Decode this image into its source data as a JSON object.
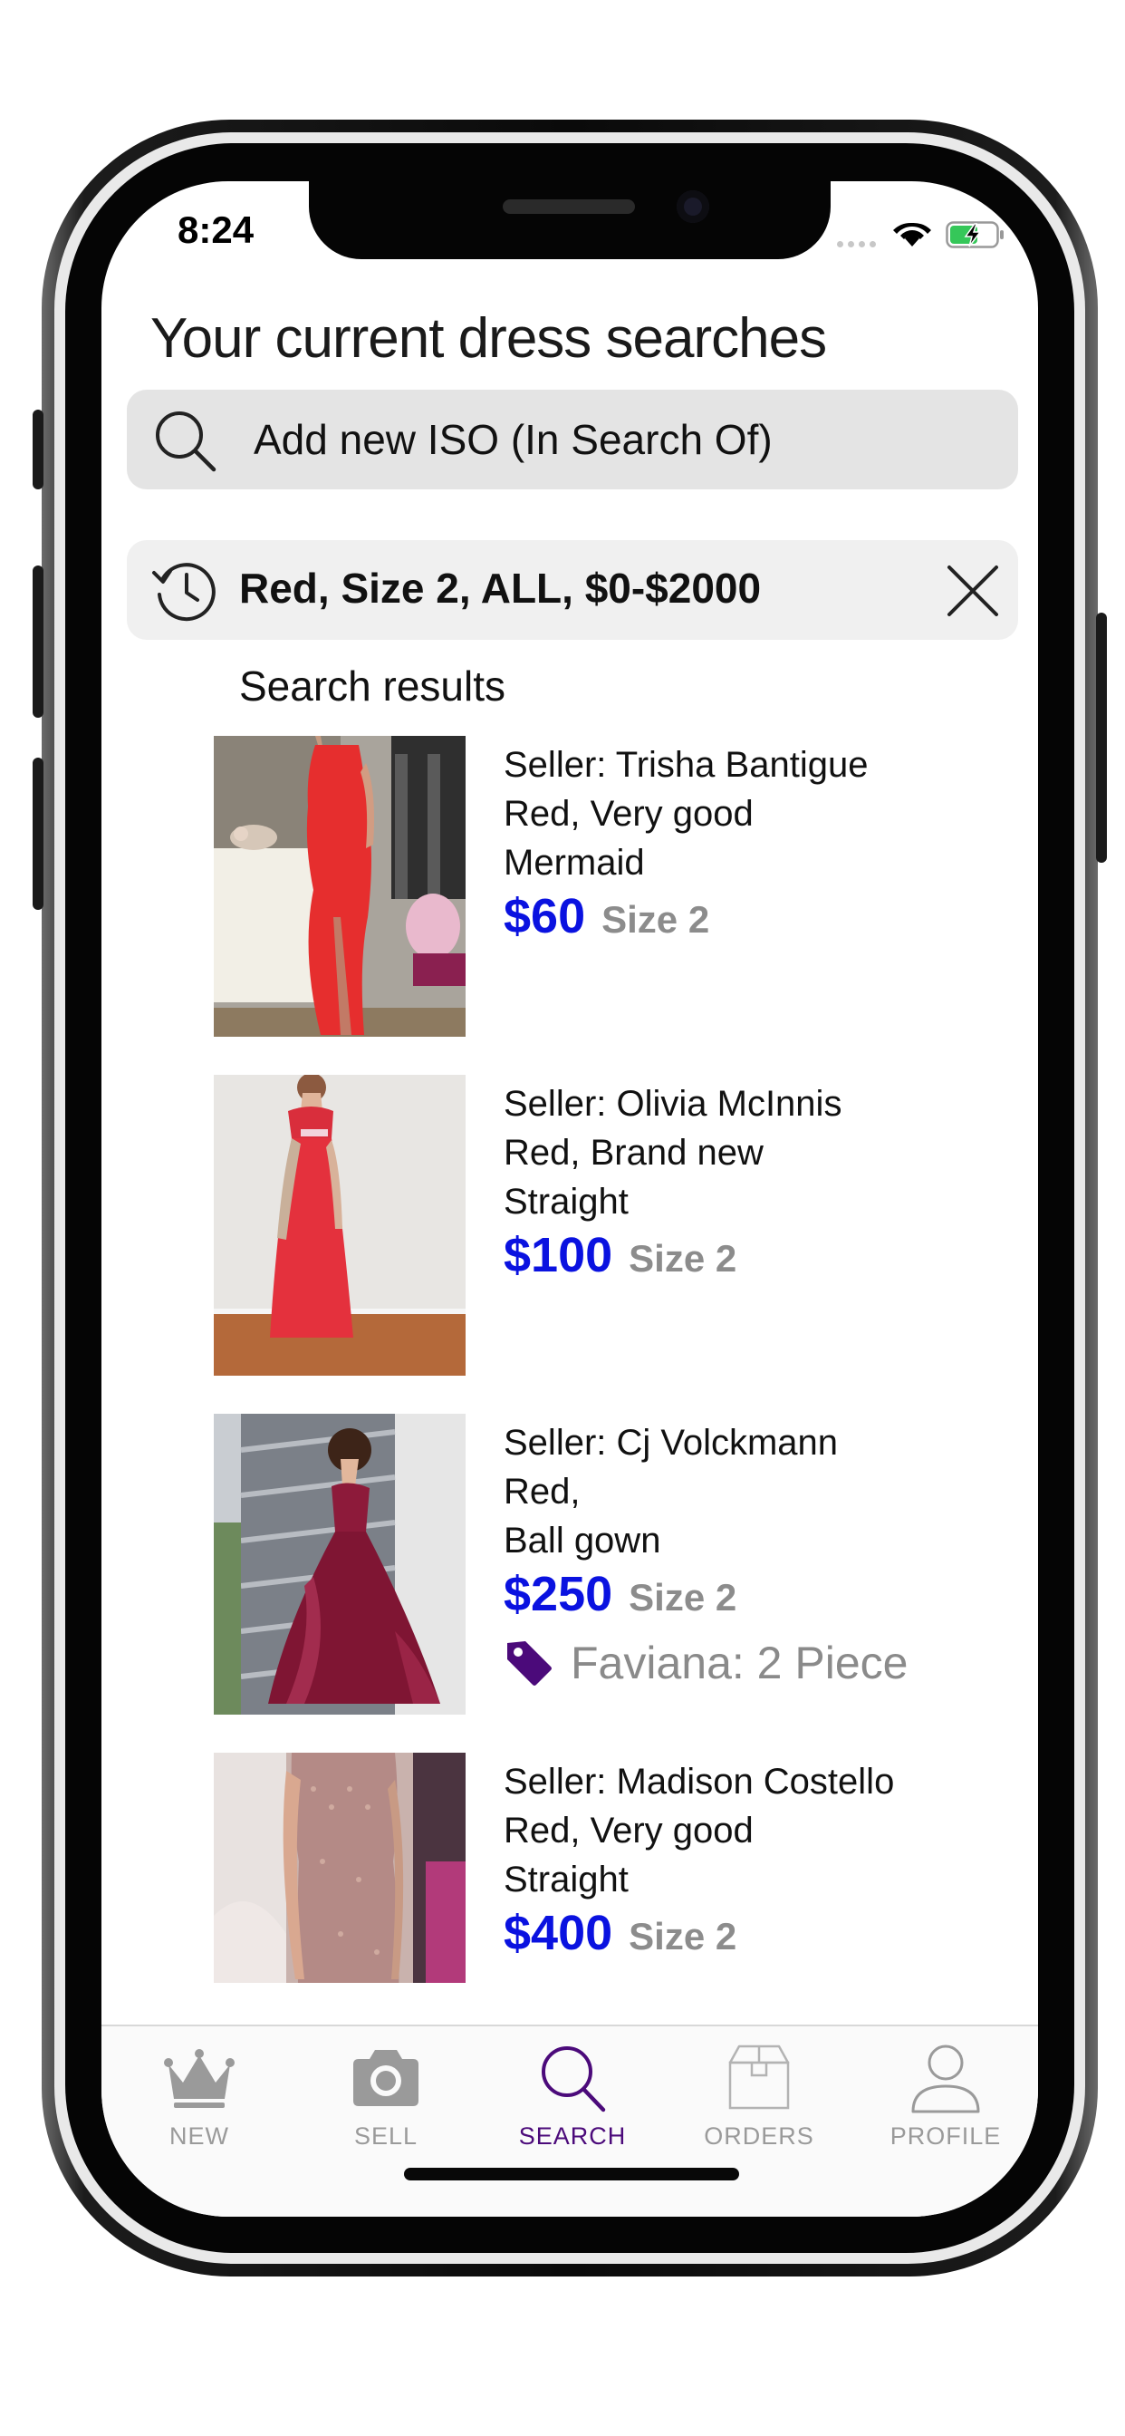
{
  "status_bar": {
    "time": "8:24"
  },
  "header": {
    "title": "Your current dress searches",
    "search_placeholder": "Add new ISO (In Search Of)"
  },
  "iso": {
    "summary": "Red, Size 2, ALL, $0-$2000"
  },
  "results": {
    "label": "Search results",
    "items": [
      {
        "seller": "Seller: Trisha Bantigue",
        "detail": "Red, Very good",
        "style": "Mermaid",
        "price": "$60",
        "size": "Size 2"
      },
      {
        "seller": "Seller: Olivia McInnis",
        "detail": "Red, Brand new",
        "style": "Straight",
        "price": "$100",
        "size": "Size 2"
      },
      {
        "seller": "Seller: Cj Volckmann",
        "detail": "Red,",
        "style": "Ball gown",
        "price": "$250",
        "size": "Size 2",
        "tag": "Faviana: 2 Piece"
      },
      {
        "seller": "Seller: Madison Costello",
        "detail": "Red, Very good",
        "style": "Straight",
        "price": "$400",
        "size": "Size 2"
      }
    ]
  },
  "tabs": [
    {
      "label": "NEW",
      "icon": "crown-icon"
    },
    {
      "label": "SELL",
      "icon": "camera-icon"
    },
    {
      "label": "SEARCH",
      "icon": "search-icon",
      "active": true
    },
    {
      "label": "ORDERS",
      "icon": "box-icon"
    },
    {
      "label": "PROFILE",
      "icon": "person-icon"
    }
  ],
  "colors": {
    "price": "#0a12e0",
    "accent": "#4b0a7a",
    "tag": "#4b0a7a",
    "muted": "#8c8c8c"
  }
}
